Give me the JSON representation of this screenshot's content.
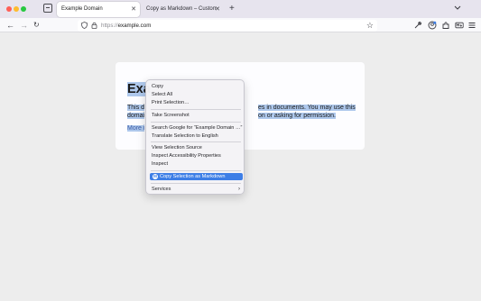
{
  "tabs": [
    {
      "label": "Example Domain",
      "active": true
    },
    {
      "label": "Copy as Markdown – Custom Format",
      "active": false
    }
  ],
  "toolbar": {
    "new_tab_glyph": "+",
    "url_scheme": "https://",
    "url_host": "example.com"
  },
  "page": {
    "heading_visible": "Exa",
    "para_line1_start": "This d",
    "para_line1_end": "es in documents. You may use this",
    "para_line2_start": "domai",
    "para_line2_end": "on or asking for permission.",
    "link_visible": "More i"
  },
  "context_menu": {
    "items": [
      {
        "label": "Copy"
      },
      {
        "label": "Select All"
      },
      {
        "label": "Print Selection…"
      },
      {
        "label": "Take Screenshot"
      },
      {
        "label": "Search Google for “Example Domain …”"
      },
      {
        "label": "Translate Selection to English"
      },
      {
        "label": "View Selection Source"
      },
      {
        "label": "Inspect Accessibility Properties"
      },
      {
        "label": "Inspect"
      },
      {
        "label": "Copy Selection as Markdown",
        "highlighted": true
      },
      {
        "label": "Services",
        "submenu": true
      }
    ]
  },
  "colors": {
    "selection": "#aec8ec",
    "menu_highlight": "#3d7ee6",
    "link": "#3f5fa8"
  }
}
